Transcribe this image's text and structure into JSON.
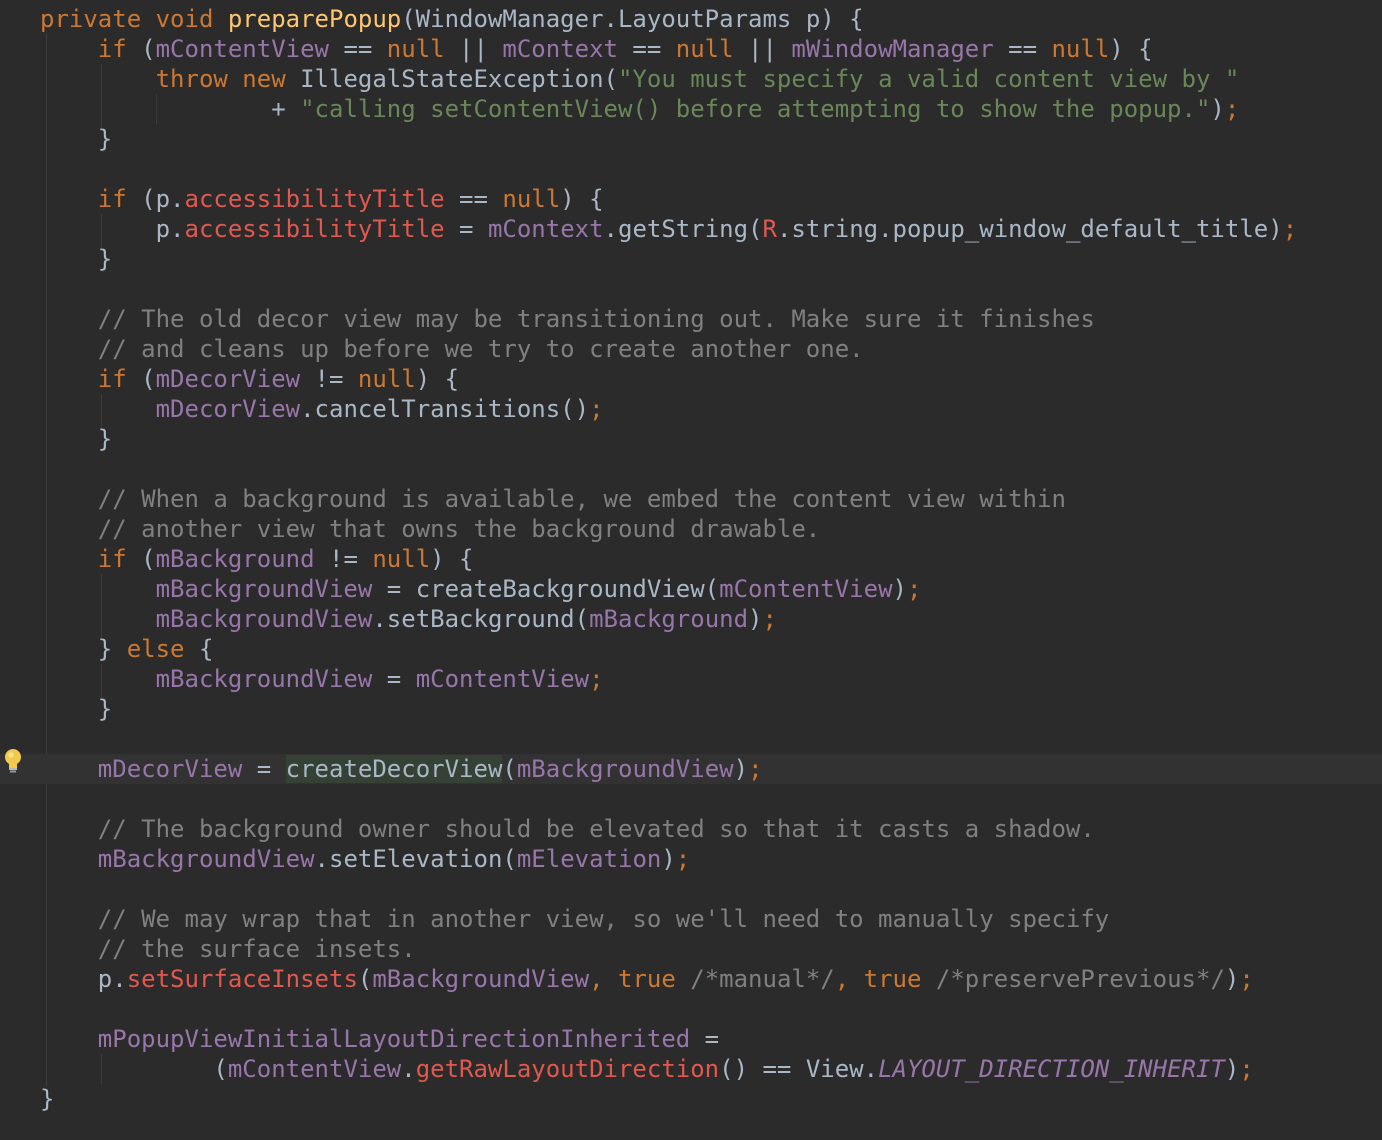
{
  "editor": {
    "language": "java",
    "theme": "darcula",
    "colors": {
      "background": "#2b2b2b",
      "current_line": "#323232",
      "keyword": "#cc7832",
      "function": "#ffc66d",
      "field": "#9876aa",
      "string": "#6a8759",
      "comment": "#808080",
      "error": "#e0584e",
      "text": "#a9b7c6"
    },
    "gutter_icon": "lightbulb-icon",
    "lines": [
      {
        "indent": 0,
        "tokens": [
          {
            "t": "kw",
            "v": "private void "
          },
          {
            "t": "fn",
            "v": "preparePopup"
          },
          {
            "t": "plain",
            "v": "(WindowManager.LayoutParams p) {"
          }
        ]
      },
      {
        "indent": 1,
        "tokens": [
          {
            "t": "kw",
            "v": "if "
          },
          {
            "t": "plain",
            "v": "("
          },
          {
            "t": "field",
            "v": "mContentView"
          },
          {
            "t": "plain",
            "v": " == "
          },
          {
            "t": "kw",
            "v": "null"
          },
          {
            "t": "plain",
            "v": " || "
          },
          {
            "t": "field",
            "v": "mContext"
          },
          {
            "t": "plain",
            "v": " == "
          },
          {
            "t": "kw",
            "v": "null"
          },
          {
            "t": "plain",
            "v": " || "
          },
          {
            "t": "field",
            "v": "mWindowManager"
          },
          {
            "t": "plain",
            "v": " == "
          },
          {
            "t": "kw",
            "v": "null"
          },
          {
            "t": "plain",
            "v": ") {"
          }
        ]
      },
      {
        "indent": 2,
        "tokens": [
          {
            "t": "kw",
            "v": "throw new "
          },
          {
            "t": "plain",
            "v": "IllegalStateException("
          },
          {
            "t": "str",
            "v": "\"You must specify a valid content view by \""
          }
        ]
      },
      {
        "indent": 4,
        "tokens": [
          {
            "t": "plain",
            "v": "+ "
          },
          {
            "t": "str",
            "v": "\"calling setContentView() before attempting to show the popup.\""
          },
          {
            "t": "plain",
            "v": ")"
          },
          {
            "t": "kw",
            "v": ";"
          }
        ]
      },
      {
        "indent": 1,
        "tokens": [
          {
            "t": "plain",
            "v": "}"
          }
        ]
      },
      {
        "indent": 0,
        "tokens": []
      },
      {
        "indent": 1,
        "tokens": [
          {
            "t": "kw",
            "v": "if "
          },
          {
            "t": "plain",
            "v": "(p."
          },
          {
            "t": "err",
            "v": "accessibilityTitle"
          },
          {
            "t": "plain",
            "v": " == "
          },
          {
            "t": "kw",
            "v": "null"
          },
          {
            "t": "plain",
            "v": ") {"
          }
        ]
      },
      {
        "indent": 2,
        "tokens": [
          {
            "t": "plain",
            "v": "p."
          },
          {
            "t": "err",
            "v": "accessibilityTitle"
          },
          {
            "t": "plain",
            "v": " = "
          },
          {
            "t": "field",
            "v": "mContext"
          },
          {
            "t": "plain",
            "v": ".getString("
          },
          {
            "t": "err",
            "v": "R"
          },
          {
            "t": "plain",
            "v": ".string.popup_window_default_title)"
          },
          {
            "t": "kw",
            "v": ";"
          }
        ]
      },
      {
        "indent": 1,
        "tokens": [
          {
            "t": "plain",
            "v": "}"
          }
        ]
      },
      {
        "indent": 0,
        "tokens": []
      },
      {
        "indent": 1,
        "tokens": [
          {
            "t": "cmt",
            "v": "// The old decor view may be transitioning out. Make sure it finishes"
          }
        ]
      },
      {
        "indent": 1,
        "tokens": [
          {
            "t": "cmt",
            "v": "// and cleans up before we try to create another one."
          }
        ]
      },
      {
        "indent": 1,
        "tokens": [
          {
            "t": "kw",
            "v": "if "
          },
          {
            "t": "plain",
            "v": "("
          },
          {
            "t": "field",
            "v": "mDecorView"
          },
          {
            "t": "plain",
            "v": " != "
          },
          {
            "t": "kw",
            "v": "null"
          },
          {
            "t": "plain",
            "v": ") {"
          }
        ]
      },
      {
        "indent": 2,
        "tokens": [
          {
            "t": "field",
            "v": "mDecorView"
          },
          {
            "t": "plain",
            "v": ".cancelTransitions()"
          },
          {
            "t": "kw",
            "v": ";"
          }
        ]
      },
      {
        "indent": 1,
        "tokens": [
          {
            "t": "plain",
            "v": "}"
          }
        ]
      },
      {
        "indent": 0,
        "tokens": []
      },
      {
        "indent": 1,
        "tokens": [
          {
            "t": "cmt",
            "v": "// When a background is available, we embed the content view within"
          }
        ]
      },
      {
        "indent": 1,
        "tokens": [
          {
            "t": "cmt",
            "v": "// another view that owns the background drawable."
          }
        ]
      },
      {
        "indent": 1,
        "tokens": [
          {
            "t": "kw",
            "v": "if "
          },
          {
            "t": "plain",
            "v": "("
          },
          {
            "t": "field",
            "v": "mBackground"
          },
          {
            "t": "plain",
            "v": " != "
          },
          {
            "t": "kw",
            "v": "null"
          },
          {
            "t": "plain",
            "v": ") {"
          }
        ]
      },
      {
        "indent": 2,
        "tokens": [
          {
            "t": "field",
            "v": "mBackgroundView"
          },
          {
            "t": "plain",
            "v": " = createBackgroundView("
          },
          {
            "t": "field",
            "v": "mContentView"
          },
          {
            "t": "plain",
            "v": ")"
          },
          {
            "t": "kw",
            "v": ";"
          }
        ]
      },
      {
        "indent": 2,
        "tokens": [
          {
            "t": "field",
            "v": "mBackgroundView"
          },
          {
            "t": "plain",
            "v": ".setBackground("
          },
          {
            "t": "field",
            "v": "mBackground"
          },
          {
            "t": "plain",
            "v": ")"
          },
          {
            "t": "kw",
            "v": ";"
          }
        ]
      },
      {
        "indent": 1,
        "tokens": [
          {
            "t": "plain",
            "v": "} "
          },
          {
            "t": "kw",
            "v": "else "
          },
          {
            "t": "plain",
            "v": "{"
          }
        ]
      },
      {
        "indent": 2,
        "tokens": [
          {
            "t": "field",
            "v": "mBackgroundView"
          },
          {
            "t": "plain",
            "v": " = "
          },
          {
            "t": "field",
            "v": "mContentView"
          },
          {
            "t": "kw",
            "v": ";"
          }
        ]
      },
      {
        "indent": 1,
        "tokens": [
          {
            "t": "plain",
            "v": "}"
          }
        ]
      },
      {
        "indent": 0,
        "tokens": []
      },
      {
        "indent": 1,
        "current": true,
        "tokens": [
          {
            "t": "field",
            "v": "mDecorView"
          },
          {
            "t": "plain",
            "v": " = "
          },
          {
            "t": "hl",
            "v": "createDecorView"
          },
          {
            "t": "plain",
            "v": "("
          },
          {
            "t": "field",
            "v": "mBackgroundView"
          },
          {
            "t": "plain",
            "v": ")"
          },
          {
            "t": "kw",
            "v": ";"
          }
        ]
      },
      {
        "indent": 0,
        "tokens": []
      },
      {
        "indent": 1,
        "tokens": [
          {
            "t": "cmt",
            "v": "// The background owner should be elevated so that it casts a shadow."
          }
        ]
      },
      {
        "indent": 1,
        "tokens": [
          {
            "t": "field",
            "v": "mBackgroundView"
          },
          {
            "t": "plain",
            "v": ".setElevation("
          },
          {
            "t": "field",
            "v": "mElevation"
          },
          {
            "t": "plain",
            "v": ")"
          },
          {
            "t": "kw",
            "v": ";"
          }
        ]
      },
      {
        "indent": 0,
        "tokens": []
      },
      {
        "indent": 1,
        "tokens": [
          {
            "t": "cmt",
            "v": "// We may wrap that in another view, so we'll need to manually specify"
          }
        ]
      },
      {
        "indent": 1,
        "tokens": [
          {
            "t": "cmt",
            "v": "// the surface insets."
          }
        ]
      },
      {
        "indent": 1,
        "tokens": [
          {
            "t": "plain",
            "v": "p."
          },
          {
            "t": "err",
            "v": "setSurfaceInsets"
          },
          {
            "t": "plain",
            "v": "("
          },
          {
            "t": "field",
            "v": "mBackgroundView"
          },
          {
            "t": "kw",
            "v": ", true "
          },
          {
            "t": "cmt",
            "v": "/*manual*/"
          },
          {
            "t": "kw",
            "v": ", true "
          },
          {
            "t": "cmt",
            "v": "/*preservePrevious*/"
          },
          {
            "t": "plain",
            "v": ")"
          },
          {
            "t": "kw",
            "v": ";"
          }
        ]
      },
      {
        "indent": 0,
        "tokens": []
      },
      {
        "indent": 1,
        "tokens": [
          {
            "t": "field",
            "v": "mPopupViewInitialLayoutDirectionInherited"
          },
          {
            "t": "plain",
            "v": " ="
          }
        ]
      },
      {
        "indent": 3,
        "tokens": [
          {
            "t": "plain",
            "v": "("
          },
          {
            "t": "field",
            "v": "mContentView"
          },
          {
            "t": "plain",
            "v": "."
          },
          {
            "t": "err",
            "v": "getRawLayoutDirection"
          },
          {
            "t": "plain",
            "v": "() == View."
          },
          {
            "t": "const",
            "v": "LAYOUT_DIRECTION_INHERIT"
          },
          {
            "t": "plain",
            "v": ")"
          },
          {
            "t": "kw",
            "v": ";"
          }
        ]
      },
      {
        "indent": 0,
        "tokens": [
          {
            "t": "plain",
            "v": "}"
          }
        ]
      }
    ]
  }
}
